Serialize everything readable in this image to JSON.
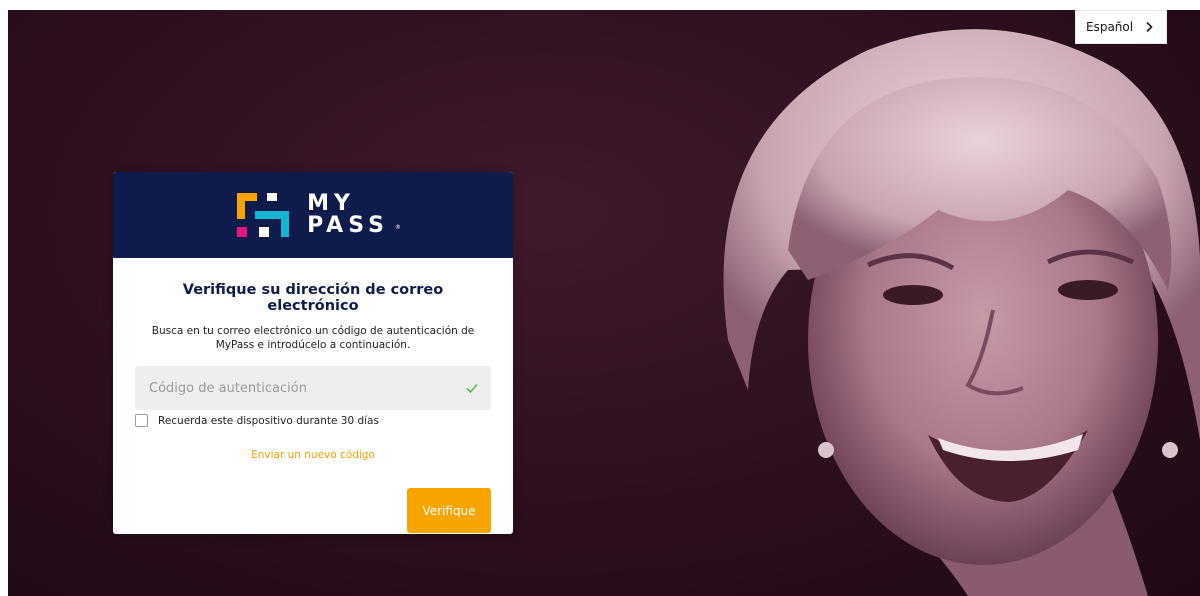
{
  "language": {
    "label": "Español",
    "icon": "chevron-right-icon"
  },
  "brand": {
    "line1": "MY",
    "line2": "PASS",
    "registered": "®",
    "colors": {
      "header_bg": "#0e1b4b",
      "accent": "#f7a401",
      "pink": "#e5177e",
      "cyan": "#13b5d4"
    }
  },
  "card": {
    "title": "Verifique su dirección de correo electrónico",
    "description": "Busca en tu correo electrónico un código de autenticación de MyPass e introdúcelo a continuación.",
    "code_input": {
      "value": "",
      "placeholder": "Código de autenticación",
      "icon": "check-icon"
    },
    "remember_label": "Recuerda este dispositivo durante 30 días",
    "resend_label": "Enviar un nuevo código",
    "verify_label": "Verifique"
  }
}
